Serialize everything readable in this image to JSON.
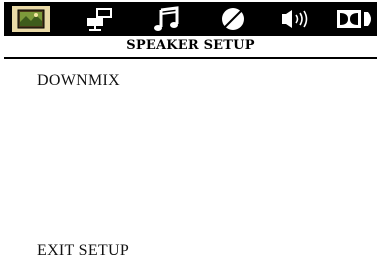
{
  "header": {
    "icons": [
      {
        "name": "picture-icon",
        "selected": true
      },
      {
        "name": "settings-icon",
        "selected": false
      },
      {
        "name": "music-icon",
        "selected": false
      },
      {
        "name": "display-icon",
        "selected": false
      },
      {
        "name": "speaker-icon",
        "selected": false
      },
      {
        "name": "dolby-icon",
        "selected": false
      }
    ]
  },
  "title": "SPEAKER SETUP",
  "menu": {
    "items": [
      {
        "label": "DOWNMIX"
      }
    ],
    "exit_label": "EXIT SETUP"
  },
  "colors": {
    "bar_background": "#000000",
    "background": "#ffffff",
    "icon_highlight": "#e9d9a6",
    "text": "#111111"
  }
}
